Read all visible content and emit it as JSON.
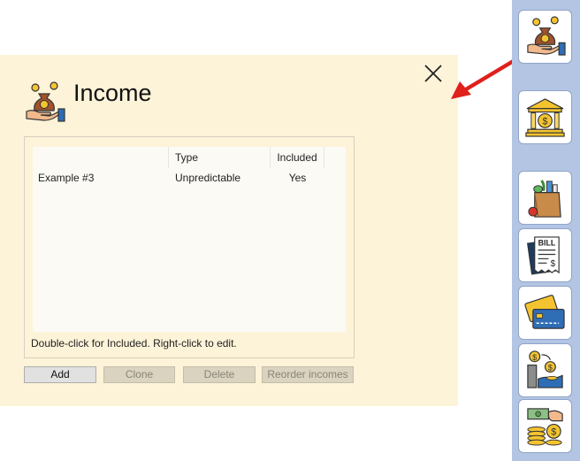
{
  "panel": {
    "title": "Income",
    "title_icon": "money-bag-hand-icon",
    "close_icon": "close-icon"
  },
  "list": {
    "columns": [
      "",
      "Type",
      "Included"
    ],
    "rows": [
      [
        "Example #3",
        "Unpredictable",
        "Yes"
      ]
    ],
    "hint": "Double-click for Included. Right-click to edit."
  },
  "buttons": {
    "add": "Add",
    "clone": "Clone",
    "delete": "Delete",
    "reorder": "Reorder incomes"
  },
  "sidebar": {
    "items": [
      {
        "icon": "income-money-bag-icon"
      },
      {
        "icon": "bank-icon"
      },
      {
        "icon": "groceries-bag-icon"
      },
      {
        "icon": "bill-icon"
      },
      {
        "icon": "credit-card-icon"
      },
      {
        "icon": "coin-transfer-icon"
      },
      {
        "icon": "cash-coins-icon"
      }
    ]
  },
  "colors": {
    "panel_bg": "#fdf3d8",
    "sidebar_bg": "#b3c5e3",
    "arrow": "#e0201b"
  }
}
